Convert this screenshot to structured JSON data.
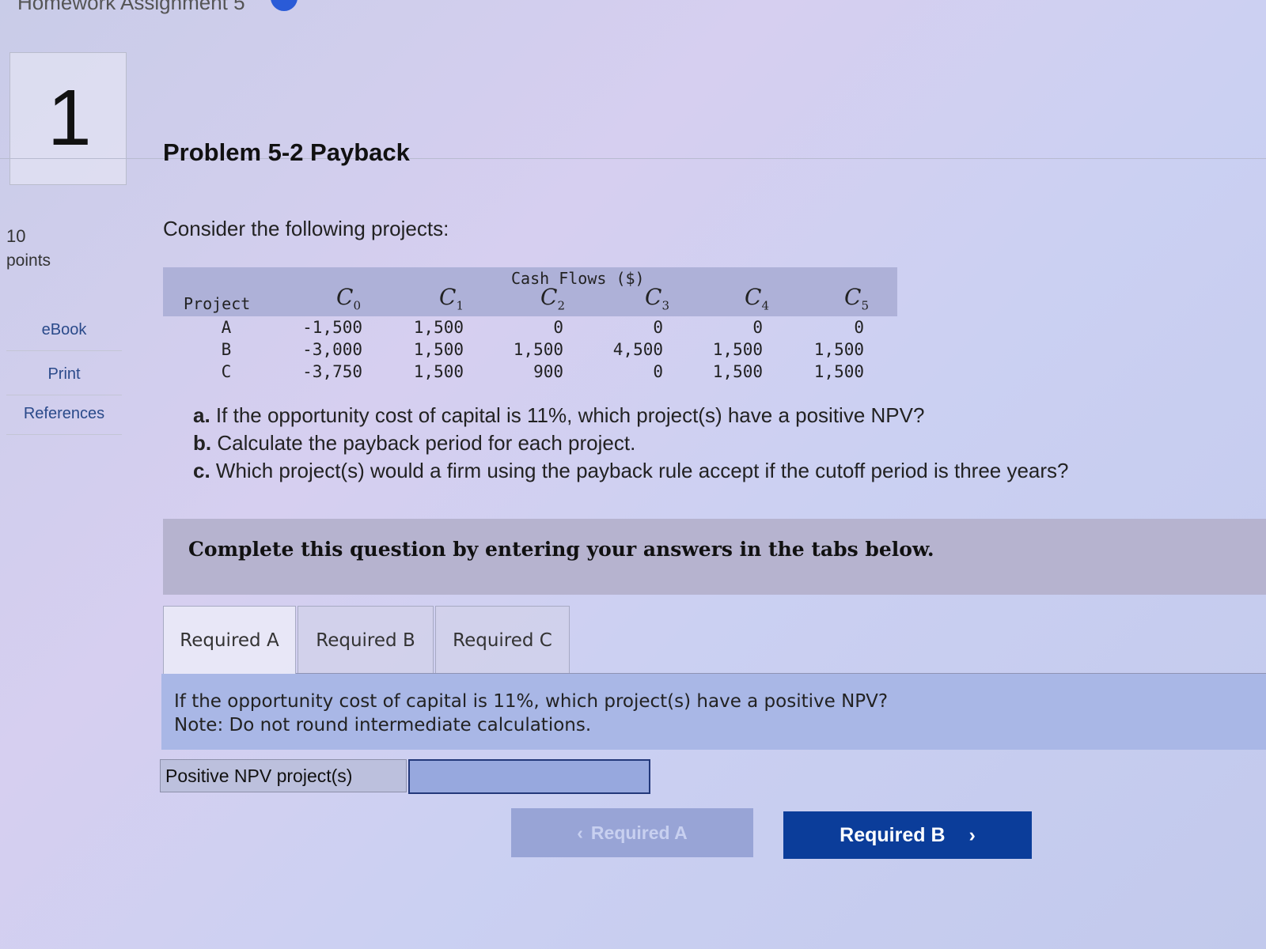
{
  "breadcrumb": "Homework Assignment 5",
  "question": {
    "number": "1",
    "points_value": "10",
    "points_label": "points",
    "title": "Problem 5-2 Payback",
    "intro": "Consider the following projects:"
  },
  "sidebar": {
    "items": [
      {
        "label": "eBook"
      },
      {
        "label": "Print"
      },
      {
        "label": "References"
      }
    ]
  },
  "cash_flow_table": {
    "caption": "Cash Flows ($)",
    "project_header": "Project",
    "columns": [
      {
        "symbol": "C",
        "sub": "0"
      },
      {
        "symbol": "C",
        "sub": "1"
      },
      {
        "symbol": "C",
        "sub": "2"
      },
      {
        "symbol": "C",
        "sub": "3"
      },
      {
        "symbol": "C",
        "sub": "4"
      },
      {
        "symbol": "C",
        "sub": "5"
      }
    ],
    "rows": [
      {
        "project": "A",
        "values": [
          "-1,500",
          "1,500",
          "0",
          "0",
          "0",
          "0"
        ]
      },
      {
        "project": "B",
        "values": [
          "-3,000",
          "1,500",
          "1,500",
          "4,500",
          "1,500",
          "1,500"
        ]
      },
      {
        "project": "C",
        "values": [
          "-3,750",
          "1,500",
          "900",
          "0",
          "1,500",
          "1,500"
        ]
      }
    ]
  },
  "questions": [
    {
      "letter": "a.",
      "text": "If the opportunity cost of capital is 11%, which project(s) have a positive NPV?"
    },
    {
      "letter": "b.",
      "text": "Calculate the payback period for each project."
    },
    {
      "letter": "c.",
      "text": "Which project(s) would a firm using the payback rule accept if the cutoff period is three years?"
    }
  ],
  "instruction": "Complete this question by entering your answers in the tabs below.",
  "tabs": [
    {
      "label": "Required A",
      "active": true
    },
    {
      "label": "Required B",
      "active": false
    },
    {
      "label": "Required C",
      "active": false
    }
  ],
  "prompt": {
    "line1": "If the opportunity cost of capital is 11%, which project(s) have a positive NPV?",
    "line2": "Note: Do not round intermediate calculations."
  },
  "answer": {
    "label": "Positive NPV project(s)",
    "value": ""
  },
  "navigation": {
    "prev_label": "Required A",
    "prev_arrow": "‹",
    "next_label": "Required B",
    "next_arrow": "›"
  },
  "colors": {
    "next_button": "#0b3d9a",
    "instruction_bar": "#b6b3cf",
    "prompt_panel": "#a9b7e6"
  }
}
